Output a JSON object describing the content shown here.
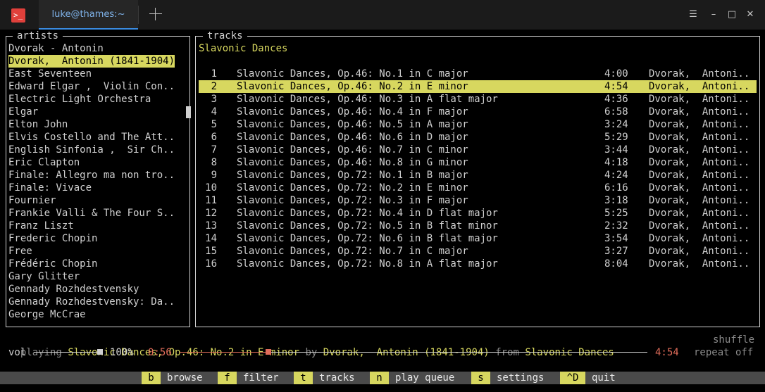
{
  "window": {
    "tab_title": "luke@thames:~",
    "app_icon_glyph": ">_"
  },
  "artists": {
    "title": "artists",
    "items": [
      "Dvorak - Antonin",
      "Dvorak,  Antonin (1841-1904)",
      "East Seventeen",
      "Edward Elgar ,  Violin Con..",
      "Electric Light Orchestra",
      "Elgar",
      "Elton John",
      "Elvis Costello and The Att..",
      "English Sinfonia ,  Sir Ch..",
      "Eric Clapton",
      "Finale: Allegro ma non tro..",
      "Finale: Vivace",
      "Fournier",
      "Frankie Valli & The Four S..",
      "Franz Liszt",
      "Frederic Chopin",
      "Free",
      "Frédéric Chopin",
      "Gary Glitter",
      "Gennady Rozhdestvensky",
      "Gennady Rozhdestvensky: Da..",
      "George McCrae"
    ],
    "selected_index": 1
  },
  "tracks": {
    "title": "tracks",
    "album": "Slavonic Dances",
    "selected_index": 1,
    "rows": [
      {
        "num": "1",
        "title": "Slavonic Dances, Op.46: No.1 in C major",
        "time": "4:00",
        "artist": "Dvorak,  Antoni.."
      },
      {
        "num": "2",
        "title": "Slavonic Dances, Op.46: No.2 in E minor",
        "time": "4:54",
        "artist": "Dvorak,  Antoni.."
      },
      {
        "num": "3",
        "title": "Slavonic Dances, Op.46: No.3 in A flat major",
        "time": "4:36",
        "artist": "Dvorak,  Antoni.."
      },
      {
        "num": "4",
        "title": "Slavonic Dances, Op.46: No.4 in F major",
        "time": "6:58",
        "artist": "Dvorak,  Antoni.."
      },
      {
        "num": "5",
        "title": "Slavonic Dances, Op.46: No.5 in A major",
        "time": "3:24",
        "artist": "Dvorak,  Antoni.."
      },
      {
        "num": "6",
        "title": "Slavonic Dances, Op.46: No.6 in D major",
        "time": "5:29",
        "artist": "Dvorak,  Antoni.."
      },
      {
        "num": "7",
        "title": "Slavonic Dances, Op.46: No.7 in C minor",
        "time": "3:44",
        "artist": "Dvorak,  Antoni.."
      },
      {
        "num": "8",
        "title": "Slavonic Dances, Op.46: No.8 in G minor",
        "time": "4:18",
        "artist": "Dvorak,  Antoni.."
      },
      {
        "num": "9",
        "title": "Slavonic Dances, Op.72: No.1 in B major",
        "time": "4:24",
        "artist": "Dvorak,  Antoni.."
      },
      {
        "num": "10",
        "title": "Slavonic Dances, Op.72: No.2 in E minor",
        "time": "6:16",
        "artist": "Dvorak,  Antoni.."
      },
      {
        "num": "11",
        "title": "Slavonic Dances, Op.72: No.3 in F major",
        "time": "3:18",
        "artist": "Dvorak,  Antoni.."
      },
      {
        "num": "12",
        "title": "Slavonic Dances, Op.72: No.4 in D flat major",
        "time": "5:25",
        "artist": "Dvorak,  Antoni.."
      },
      {
        "num": "13",
        "title": "Slavonic Dances, Op.72: No.5 in B flat minor",
        "time": "2:32",
        "artist": "Dvorak,  Antoni.."
      },
      {
        "num": "14",
        "title": "Slavonic Dances, Op.72: No.6 in B flat major",
        "time": "3:54",
        "artist": "Dvorak,  Antoni.."
      },
      {
        "num": "15",
        "title": "Slavonic Dances, Op.72: No.7 in C major",
        "time": "3:27",
        "artist": "Dvorak,  Antoni.."
      },
      {
        "num": "16",
        "title": "Slavonic Dances, Op.72: No.8 in A flat major",
        "time": "8:04",
        "artist": "Dvorak,  Antoni.."
      }
    ]
  },
  "status": {
    "playing_label": "playing",
    "track": "Slavonic Dances, Op.46: No.2 in E minor",
    "by_label": "by",
    "artist": "Dvorak,  Antonin (1841-1904)",
    "from_label": "from",
    "album": "Slavonic Dances",
    "shuffle": "shuffle",
    "vol_label": "vol",
    "volume": "100%",
    "volume_fraction": 1.0,
    "elapsed": "0:56",
    "duration": "4:54",
    "progress_fraction": 0.19,
    "repeat": "repeat off"
  },
  "keybar": [
    {
      "key": "b",
      "label": "browse"
    },
    {
      "key": "f",
      "label": "filter"
    },
    {
      "key": "t",
      "label": "tracks"
    },
    {
      "key": "n",
      "label": "play queue"
    },
    {
      "key": "s",
      "label": "settings"
    },
    {
      "key": "^D",
      "label": "quit"
    }
  ],
  "icons": {
    "new_tab": "plus-icon",
    "menu": "hamburger-icon",
    "minimize": "minimize-icon",
    "maximize": "maximize-icon",
    "close": "close-icon"
  },
  "colors": {
    "highlight": "#d7d75f",
    "accent_blue": "#3b8be0",
    "progress": "#e06c5a"
  }
}
